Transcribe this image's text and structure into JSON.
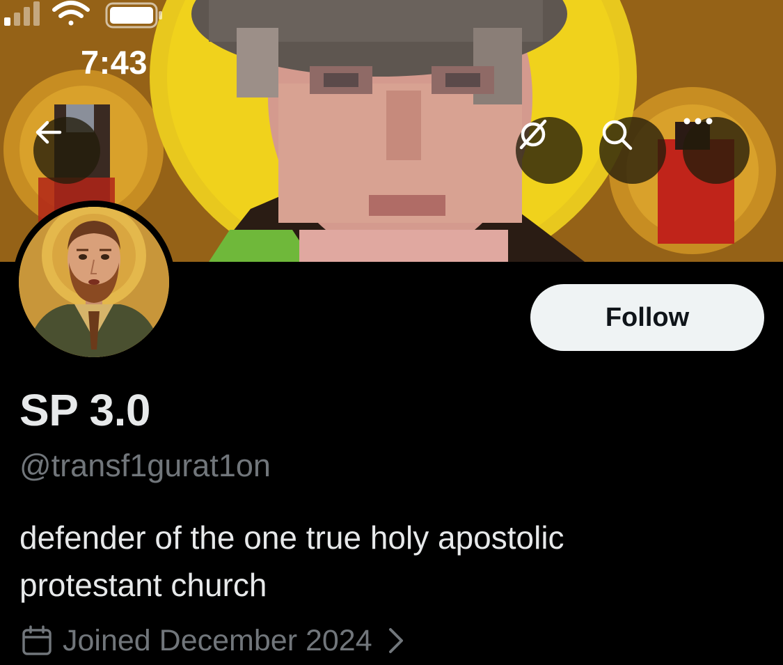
{
  "status_bar": {
    "time": "7:43",
    "icons": [
      "cellular-signal-icon",
      "wifi-icon",
      "battery-icon"
    ]
  },
  "nav": {
    "back_icon": "arrow-left-icon",
    "grok_icon": "grok-icon",
    "search_icon": "search-icon",
    "more_icon": "more-horizontal-icon"
  },
  "profile": {
    "banner": "pixelated icon-style image with yellow halos",
    "avatar": "icon-style portrait of bearded man with halo",
    "display_name": "SP 3.0",
    "handle": "@transf1gurat1on",
    "bio_line1": "defender of the one true holy apostolic",
    "bio_line2": "protestant church",
    "joined": "Joined December 2024",
    "follow_label": "Follow"
  },
  "colors": {
    "background": "#000000",
    "primary_text": "#e7e9ea",
    "secondary_text": "#71767b",
    "follow_bg": "#eff3f4",
    "follow_text": "#0f1419"
  }
}
